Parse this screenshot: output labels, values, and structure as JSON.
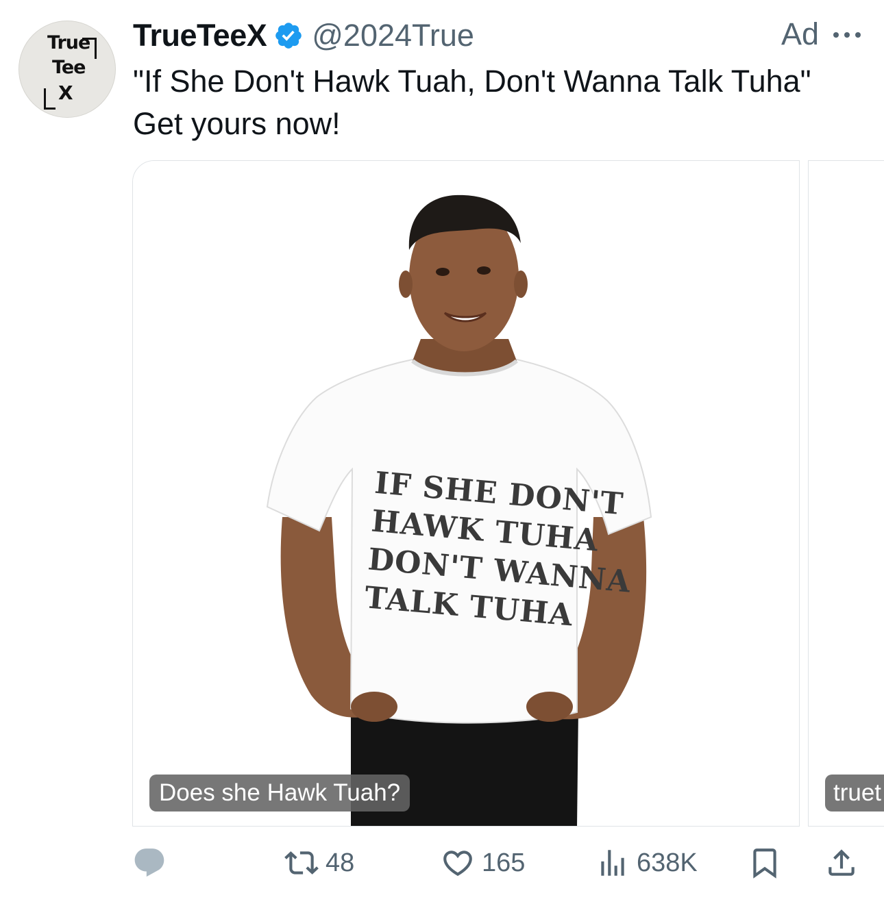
{
  "account": {
    "avatar_logo": {
      "line1": "True",
      "line2": "Tee",
      "line3": "X"
    },
    "display_name": "TrueTeeX",
    "verified": true,
    "handle": "@2024True",
    "ad_label": "Ad"
  },
  "tweet": {
    "text_line1": "\"If She Don't Hawk Tuah, Don't Wanna Talk Tuha\"",
    "text_line2": "Get yours now!"
  },
  "media": {
    "cards": [
      {
        "caption": "Does she Hawk Tuah?",
        "shirt_print": [
          "IF SHE DON'T",
          "HAWK TUHA",
          "DON'T WANNA",
          "TALK TUHA"
        ]
      },
      {
        "caption": "truet"
      }
    ]
  },
  "actions": {
    "reply_count": "",
    "retweet_count": "48",
    "like_count": "165",
    "view_count": "638K"
  },
  "icons": {
    "reply": "reply-icon",
    "retweet": "retweet-icon",
    "like": "heart-icon",
    "views": "views-chart-icon",
    "bookmark": "bookmark-icon",
    "share": "share-icon",
    "more": "more-dots-icon",
    "verified": "verified-badge-icon"
  },
  "colors": {
    "verified_blue": "#1d9bf0",
    "muted_text": "#536471",
    "primary_text": "#0f1419"
  }
}
